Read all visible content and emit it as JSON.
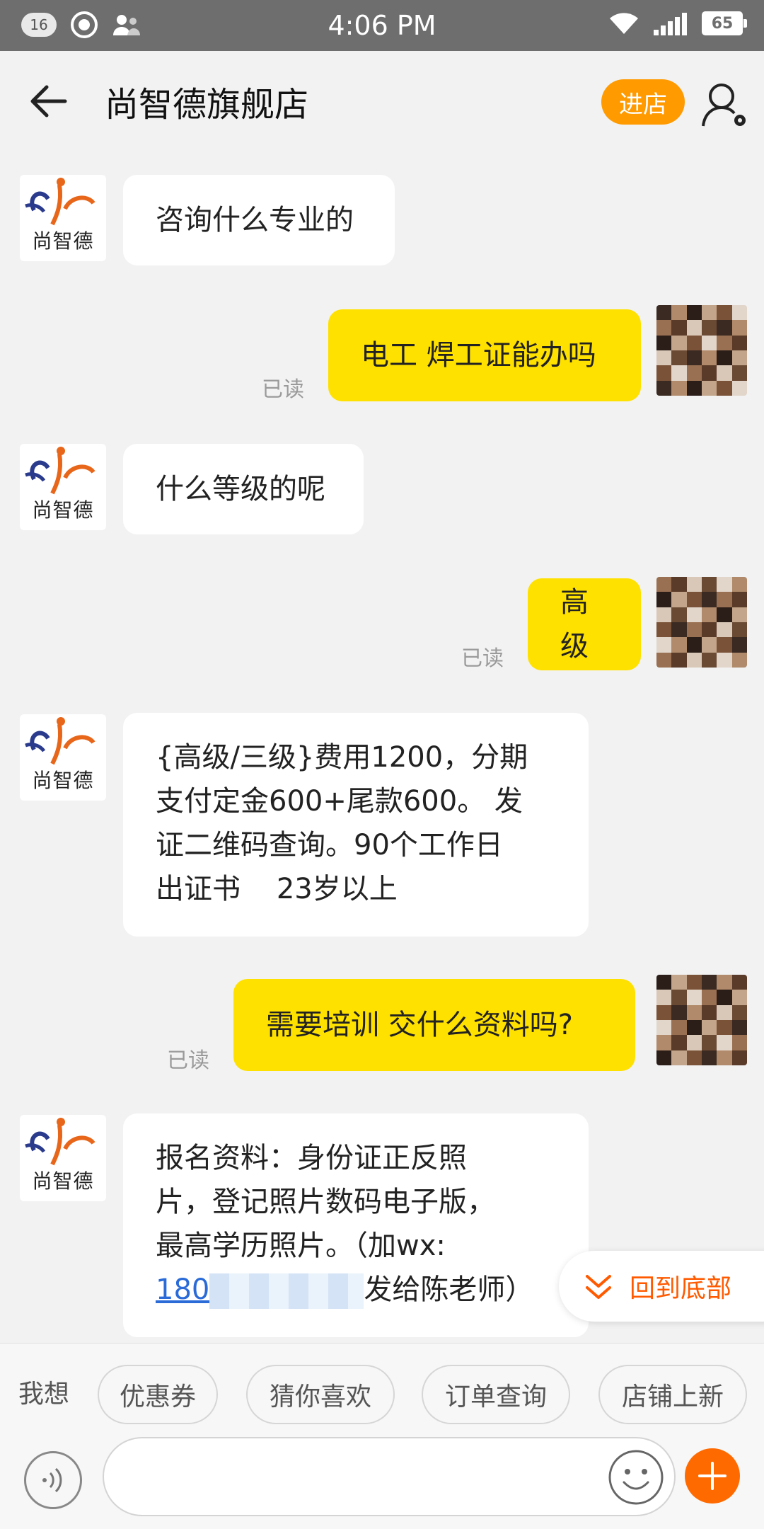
{
  "status_bar": {
    "notification_count": "16",
    "time": "4:06 PM",
    "battery": "65"
  },
  "header": {
    "title": "尚智德旗舰店",
    "enter_button": "进店"
  },
  "shop_logo_text": "尚智德",
  "messages": [
    {
      "side": "left",
      "text": "咨询什么专业的"
    },
    {
      "side": "right",
      "text": "电工 焊工证能办吗",
      "status": "已读"
    },
    {
      "side": "left",
      "text": "什么等级的呢"
    },
    {
      "side": "right",
      "text": "高级",
      "status": "已读"
    },
    {
      "side": "left",
      "lines": [
        "{高级/三级}费用1200，分期",
        "支付定金600+尾款600。 发",
        "证二维码查询。90个工作日",
        "出证书    23岁以上"
      ]
    },
    {
      "side": "right",
      "text": "需要培训 交什么资料吗?",
      "status": "已读"
    },
    {
      "side": "left",
      "lines": [
        "报名资料：身份证正反照",
        "片，登记照片数码电子版，",
        "最高学历照片。（加wx:"
      ],
      "link_prefix": "180",
      "line4_suffix": "发给陈老师）"
    }
  ],
  "back_to_bottom": "回到底部",
  "quick_bar": {
    "label": "我想",
    "chips": [
      "优惠券",
      "猜你喜欢",
      "订单查询",
      "店铺上新"
    ]
  },
  "input": {
    "placeholder": ""
  },
  "colors": {
    "accent_orange": "#ff9a00",
    "bubble_yellow": "#ffe100",
    "link_blue": "#2a6bd8"
  }
}
